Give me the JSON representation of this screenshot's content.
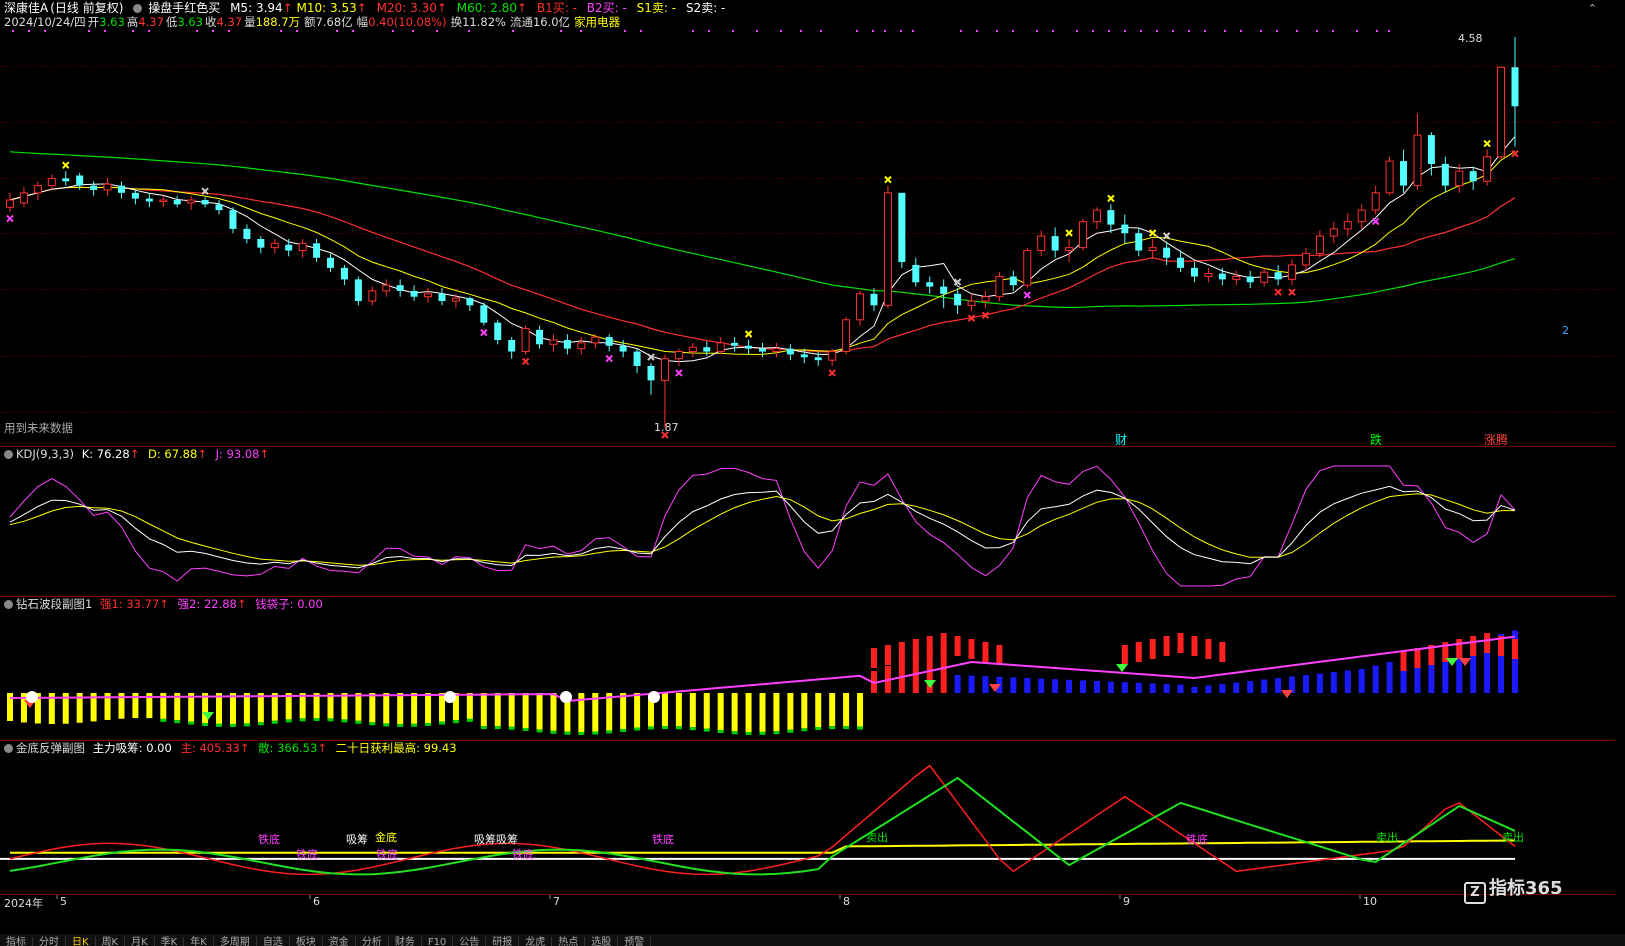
{
  "window": {
    "title": "深康佳A",
    "mode": "(日线 前复权)",
    "indicator": "操盘手红色买",
    "ma": [
      {
        "label": "M5:",
        "value": "3.94",
        "arrow": "↑",
        "color": "#ffffff"
      },
      {
        "label": "M10:",
        "value": "3.53",
        "arrow": "↑",
        "color": "#ffff00"
      },
      {
        "label": "M20:",
        "value": "3.30",
        "arrow": "↑",
        "color": "#ff3030"
      },
      {
        "label": "M60:",
        "value": "2.80",
        "arrow": "↑",
        "color": "#00e000"
      }
    ],
    "signals": [
      {
        "text": "B1买: -",
        "color": "#ff3030"
      },
      {
        "text": "B2买: -",
        "color": "#ff40ff"
      },
      {
        "text": "S1卖: -",
        "color": "#ffff00"
      },
      {
        "text": "S2卖: -",
        "color": "#ffffff"
      }
    ],
    "corner_icon": "up-arrow-icon"
  },
  "quote": {
    "date": "2024/10/24/四",
    "open_label": "开",
    "open": "3.63",
    "high_label": "高",
    "high": "4.37",
    "low_label": "低",
    "low": "3.63",
    "close_label": "收",
    "close": "4.37",
    "vol_label": "量",
    "vol": "188.7万",
    "amt_label": "额",
    "amt": "7.68亿",
    "chg_label": "幅",
    "chg": "0.40(10.08%)",
    "turn_label": "换",
    "turn": "11.82%",
    "float_label": "流通",
    "float": "16.0亿",
    "sector": "家用电器"
  },
  "main_chart": {
    "future_note": "用到未来数据",
    "high_mark": "4.58",
    "low_mark": "1.87",
    "tags": [
      {
        "text": "财",
        "color": "#00ffff"
      },
      {
        "text": "跌",
        "color": "#00ff00"
      },
      {
        "text": "涨腾",
        "color": "#ff4040"
      }
    ],
    "right_mark": "2"
  },
  "kdj": {
    "name": "KDJ(9,3,3)",
    "k_label": "K:",
    "k": "76.28",
    "d_label": "D:",
    "d": "67.88",
    "j_label": "J:",
    "j": "93.08",
    "arrow": "↑"
  },
  "diamond": {
    "name": "钻石波段副图1",
    "s1_label": "强1:",
    "s1": "33.77",
    "s2_label": "强2:",
    "s2": "22.88",
    "bag_label": "钱袋子:",
    "bag": "0.00",
    "arrow": "↑"
  },
  "golden": {
    "name": "金底反弹副图",
    "absorb_label": "主力吸筹:",
    "absorb": "0.00",
    "main_label": "主:",
    "main": "405.33",
    "retail_label": "散:",
    "retail": "366.53",
    "profit_label": "二十日获利最高:",
    "profit": "99.43",
    "arrow": "↑",
    "labels": [
      {
        "text": "铁底",
        "color": "#ff40ff"
      },
      {
        "text": "铁底",
        "color": "#ff40ff"
      },
      {
        "text": "吸筹",
        "color": "#ffffff"
      },
      {
        "text": "金底",
        "color": "#ffff00"
      },
      {
        "text": "铁底",
        "color": "#ff40ff"
      },
      {
        "text": "吸筹吸筹",
        "color": "#ffffff"
      },
      {
        "text": "铁底",
        "color": "#ff40ff"
      },
      {
        "text": "铁底",
        "color": "#ff40ff"
      },
      {
        "text": "卖出",
        "color": "#00e000"
      },
      {
        "text": "铁底",
        "color": "#ff40ff"
      },
      {
        "text": "卖出",
        "color": "#00e000"
      },
      {
        "text": "卖出",
        "color": "#00e000"
      }
    ]
  },
  "axis": {
    "year": "2024年",
    "months": [
      "5",
      "6",
      "7",
      "8",
      "9",
      "10"
    ]
  },
  "watermark": "指标365",
  "bottom_tabs": [
    "指标",
    "分时",
    "日K",
    "周K",
    "月K",
    "季K",
    "年K",
    "多周期",
    "自选",
    "板块",
    "资金",
    "分析",
    "财务",
    "F10",
    "公告",
    "研报",
    "龙虎",
    "热点",
    "选股",
    "预警"
  ],
  "colors": {
    "up": "#ff3030",
    "down": "#54ffff",
    "ma5": "#ffffff",
    "ma10": "#ffff00",
    "ma20": "#ff3030",
    "ma60": "#00e000",
    "k": "#ffffff",
    "d": "#ffff00",
    "j": "#ff40ff",
    "bg": "#000000",
    "grid": "#7a0000"
  }
}
